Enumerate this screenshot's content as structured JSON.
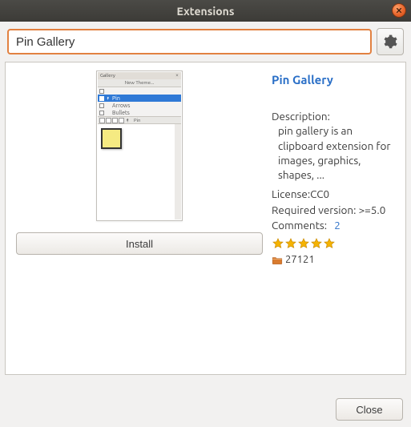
{
  "window": {
    "title": "Extensions"
  },
  "search": {
    "value": "Pin Gallery",
    "placeholder": ""
  },
  "thumbnail": {
    "panel_title": "Gallery",
    "new_theme": "New Theme...",
    "rows": [
      {
        "label": "",
        "selected": false
      },
      {
        "label": "Pin",
        "selected": true
      },
      {
        "label": "Arrows",
        "selected": false
      },
      {
        "label": "Bullets",
        "selected": false
      }
    ],
    "toolbar_label": "Pin"
  },
  "install_label": "Install",
  "extension": {
    "title": "Pin Gallery",
    "description_label": "Description:",
    "description": "pin gallery is an clipboard extension for images, graphics, shapes, ...",
    "license_label": "License:",
    "license": "CC0",
    "required_label": "Required version:",
    "required": ">=5.0",
    "comments_label": "Comments:",
    "comments_count": "2",
    "rating_stars": 5,
    "downloads": "27121"
  },
  "footer": {
    "close": "Close"
  }
}
